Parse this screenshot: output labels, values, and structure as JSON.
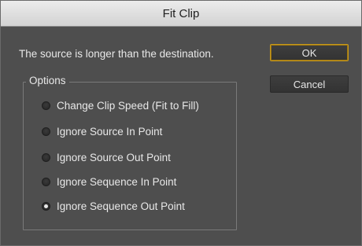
{
  "window": {
    "title": "Fit Clip"
  },
  "message": "The source is longer than the destination.",
  "buttons": {
    "ok": "OK",
    "cancel": "Cancel"
  },
  "options": {
    "legend": "Options",
    "items": [
      {
        "label": "Change Clip Speed (Fit to Fill)",
        "selected": false
      },
      {
        "label": "Ignore Source In Point",
        "selected": false
      },
      {
        "label": "Ignore Source Out Point",
        "selected": false
      },
      {
        "label": "Ignore Sequence In Point",
        "selected": false
      },
      {
        "label": "Ignore Sequence Out Point",
        "selected": true
      }
    ]
  }
}
